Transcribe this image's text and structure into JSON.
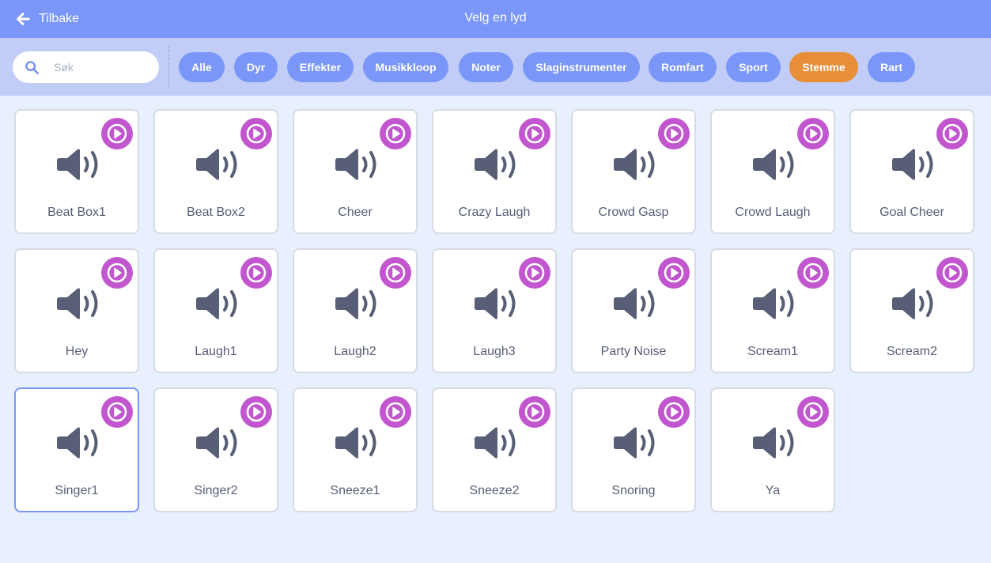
{
  "header": {
    "back_label": "Tilbake",
    "title": "Velg en lyd"
  },
  "search": {
    "placeholder": "Søk",
    "value": ""
  },
  "tags": [
    {
      "label": "Alle",
      "active": false
    },
    {
      "label": "Dyr",
      "active": false
    },
    {
      "label": "Effekter",
      "active": false
    },
    {
      "label": "Musikkloop",
      "active": false
    },
    {
      "label": "Noter",
      "active": false
    },
    {
      "label": "Slaginstrumenter",
      "active": false
    },
    {
      "label": "Romfart",
      "active": false
    },
    {
      "label": "Sport",
      "active": false
    },
    {
      "label": "Stemme",
      "active": true
    },
    {
      "label": "Rart",
      "active": false
    }
  ],
  "sounds": [
    {
      "label": "Beat Box1",
      "selected": false
    },
    {
      "label": "Beat Box2",
      "selected": false
    },
    {
      "label": "Cheer",
      "selected": false
    },
    {
      "label": "Crazy Laugh",
      "selected": false
    },
    {
      "label": "Crowd Gasp",
      "selected": false
    },
    {
      "label": "Crowd Laugh",
      "selected": false
    },
    {
      "label": "Goal Cheer",
      "selected": false
    },
    {
      "label": "Hey",
      "selected": false
    },
    {
      "label": "Laugh1",
      "selected": false
    },
    {
      "label": "Laugh2",
      "selected": false
    },
    {
      "label": "Laugh3",
      "selected": false
    },
    {
      "label": "Party Noise",
      "selected": false
    },
    {
      "label": "Scream1",
      "selected": false
    },
    {
      "label": "Scream2",
      "selected": false
    },
    {
      "label": "Singer1",
      "selected": true
    },
    {
      "label": "Singer2",
      "selected": false
    },
    {
      "label": "Sneeze1",
      "selected": false
    },
    {
      "label": "Sneeze2",
      "selected": false
    },
    {
      "label": "Snoring",
      "selected": false
    },
    {
      "label": "Ya",
      "selected": false
    }
  ],
  "colors": {
    "header": "#7a96f8",
    "filterbar": "#c1cdf6",
    "background": "#e9f0fd",
    "tag": "#7a96f8",
    "tag_active": "#e98e38",
    "play_button": "#c256cf",
    "speaker_icon": "#575e75"
  },
  "icons": {
    "back": "arrow-left-icon",
    "search": "search-icon",
    "sound": "speaker-icon",
    "play": "play-icon"
  }
}
